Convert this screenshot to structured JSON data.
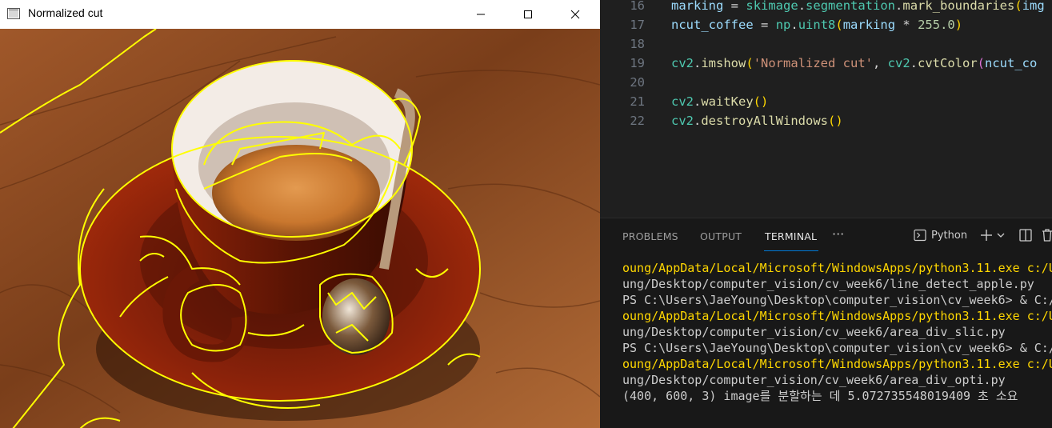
{
  "image_window": {
    "title": "Normalized cut",
    "controls": [
      "minimize-icon",
      "maximize-icon",
      "close-icon"
    ]
  },
  "editor": {
    "lines": [
      {
        "num": "16",
        "text": "marking = skimage.segmentation.mark_boundaries(img"
      },
      {
        "num": "17",
        "text": "ncut_coffee = np.uint8(marking * 255.0)"
      },
      {
        "num": "18",
        "text": ""
      },
      {
        "num": "19",
        "text": "cv2.imshow('Normalized cut', cv2.cvtColor(ncut_co"
      },
      {
        "num": "20",
        "text": ""
      },
      {
        "num": "21",
        "text": "cv2.waitKey()"
      },
      {
        "num": "22",
        "text": "cv2.destroyAllWindows()"
      }
    ]
  },
  "panel": {
    "tabs": [
      "PROBLEMS",
      "OUTPUT",
      "TERMINAL"
    ],
    "active_tab": "TERMINAL",
    "more": "···",
    "terminal_profile": "Python",
    "toolbar_icons": [
      "plus-icon",
      "chevron-down-icon",
      "split-icon",
      "trash-icon"
    ],
    "terminal_lines": [
      {
        "text": "oung/AppData/Local/Microsoft/WindowsApps/python3.11.exe c:/U",
        "highlight": true
      },
      {
        "text": "ung/Desktop/computer_vision/cv_week6/line_detect_apple.py",
        "highlight": false
      },
      {
        "text": "PS C:\\Users\\JaeYoung\\Desktop\\computer_vision\\cv_week6> & C:/",
        "highlight": false
      },
      {
        "text": "oung/AppData/Local/Microsoft/WindowsApps/python3.11.exe c:/U",
        "highlight": true
      },
      {
        "text": "ung/Desktop/computer_vision/cv_week6/area_div_slic.py",
        "highlight": false
      },
      {
        "text": "PS C:\\Users\\JaeYoung\\Desktop\\computer_vision\\cv_week6> & C:/",
        "highlight": false
      },
      {
        "text": "oung/AppData/Local/Microsoft/WindowsApps/python3.11.exe c:/U",
        "highlight": true
      },
      {
        "text": "ung/Desktop/computer_vision/cv_week6/area_div_opti.py",
        "highlight": false
      },
      {
        "text": "(400, 600, 3) image를 분할하는 데 5.072735548019409 초 소요",
        "highlight": false
      }
    ]
  }
}
